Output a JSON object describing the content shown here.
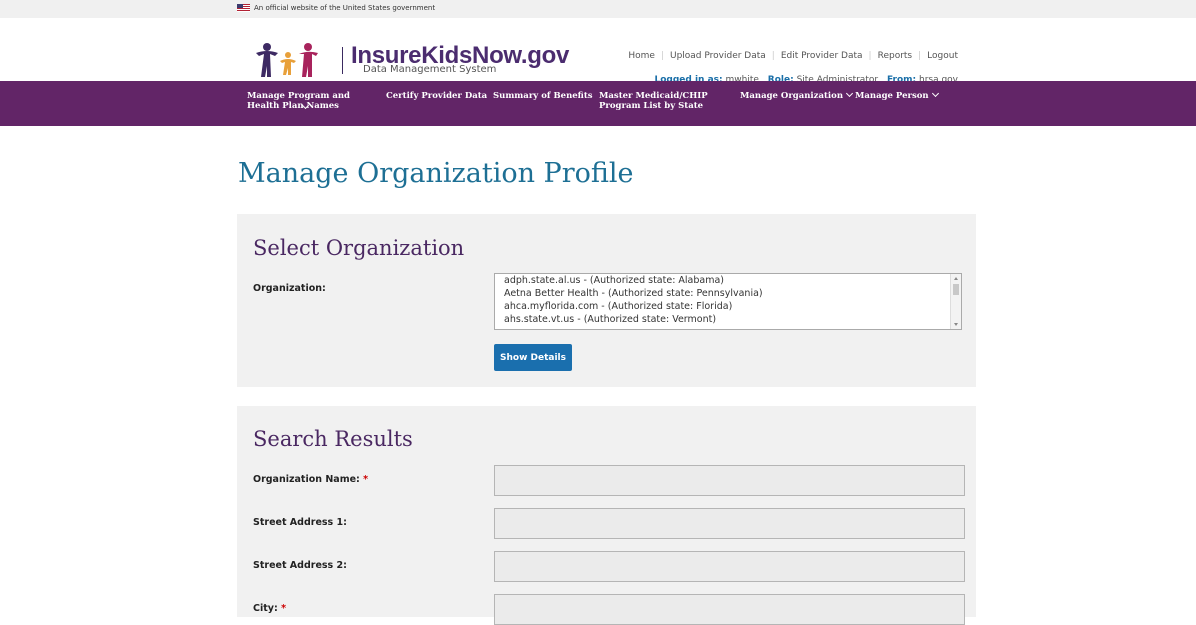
{
  "gov_banner": {
    "text": "An official website of the United States government"
  },
  "header": {
    "title": "InsureKidsNow.gov",
    "subtitle": "Data Management System"
  },
  "top_nav": [
    "Home",
    "Upload Provider Data",
    "Edit Provider Data",
    "Reports",
    "Logout"
  ],
  "login": {
    "logged_in_label": "Logged in as:",
    "user": "mwhite",
    "role_label": "Role:",
    "role": "Site Administrator",
    "from_label": "From:",
    "from": "hrsa.gov"
  },
  "main_nav": [
    {
      "label": "Manage Program and Health Plan Names",
      "dropdown": true
    },
    {
      "label": "Certify Provider Data",
      "dropdown": false
    },
    {
      "label": "Summary of Benefits",
      "dropdown": false
    },
    {
      "label": "Master Medicaid/CHIP Program List by State",
      "dropdown": false
    },
    {
      "label": "Manage Organization",
      "dropdown": true
    },
    {
      "label": "Manage Person",
      "dropdown": true
    }
  ],
  "page_title": "Manage Organization Profile",
  "select_org": {
    "heading": "Select Organization",
    "label": "Organization:",
    "options": [
      "adph.state.al.us - (Authorized state: Alabama)",
      "Aetna Better Health - (Authorized state: Pennsylvania)",
      "ahca.myflorida.com - (Authorized state: Florida)",
      "ahs.state.vt.us - (Authorized state: Vermont)"
    ],
    "button": "Show Details"
  },
  "search_results": {
    "heading": "Search Results",
    "fields": [
      {
        "label": "Organization Name:",
        "required": "*",
        "value": ""
      },
      {
        "label": "Street Address 1:",
        "required": "",
        "value": ""
      },
      {
        "label": "Street Address 2:",
        "required": "",
        "value": ""
      },
      {
        "label": "City:",
        "required": "*",
        "value": ""
      }
    ]
  },
  "colors": {
    "nav_bg": "#622567",
    "title": "#1d6f94",
    "button": "#1a6fae",
    "heading": "#4a2862"
  }
}
